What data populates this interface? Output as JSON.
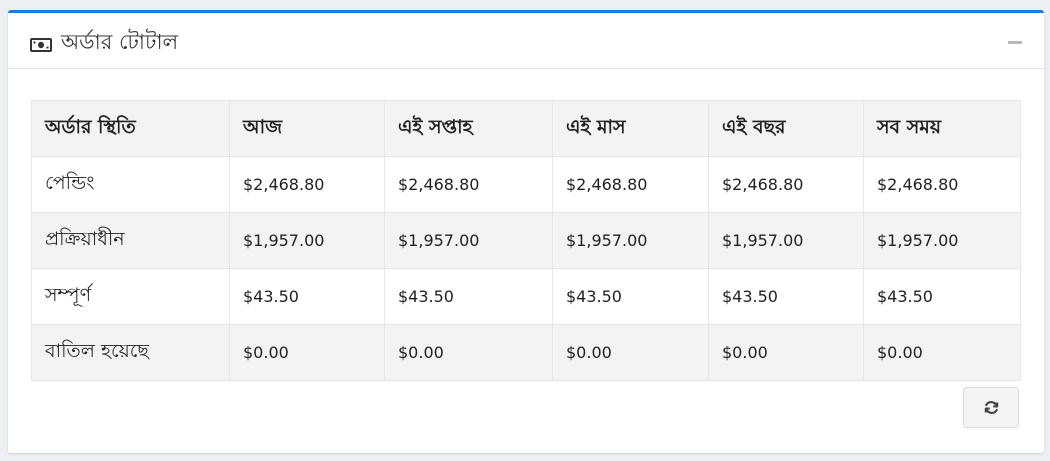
{
  "card": {
    "title": "অর্ডার টোটাল",
    "accent_color": "#1a7ee0",
    "title_icon": "money-icon",
    "collapse_icon": "minus-icon"
  },
  "table": {
    "headers": [
      "অর্ডার স্থিতি",
      "আজ",
      "এই সপ্তাহ",
      "এই মাস",
      "এই বছর",
      "সব সময়"
    ],
    "rows": [
      {
        "label": "পেন্ডিং",
        "values": [
          "$2,468.80",
          "$2,468.80",
          "$2,468.80",
          "$2,468.80",
          "$2,468.80"
        ]
      },
      {
        "label": "প্রক্রিয়াধীন",
        "values": [
          "$1,957.00",
          "$1,957.00",
          "$1,957.00",
          "$1,957.00",
          "$1,957.00"
        ]
      },
      {
        "label": "সম্পূর্ণ",
        "values": [
          "$43.50",
          "$43.50",
          "$43.50",
          "$43.50",
          "$43.50"
        ]
      },
      {
        "label": "বাতিল হয়েছে",
        "values": [
          "$0.00",
          "$0.00",
          "$0.00",
          "$0.00",
          "$0.00"
        ]
      }
    ]
  },
  "footer": {
    "refresh_icon": "refresh-icon"
  }
}
